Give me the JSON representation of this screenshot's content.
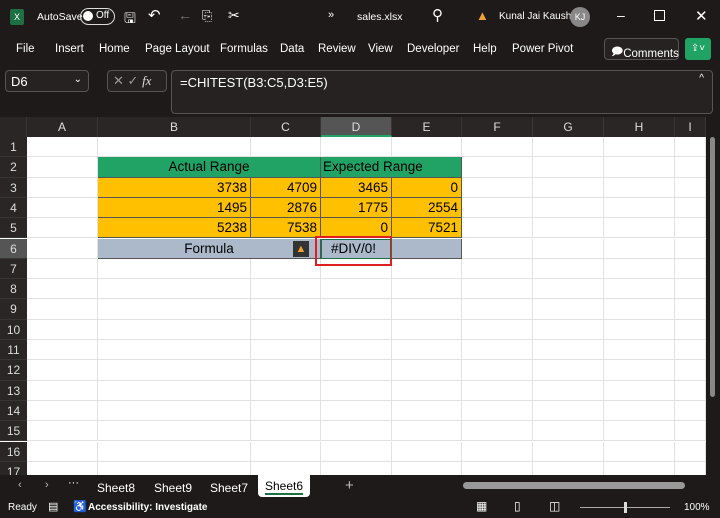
{
  "titlebar": {
    "autosave": "AutoSave",
    "toggle": "Off",
    "filename": "sales.xlsx",
    "user": "Kunal Jai Kaushik",
    "initials": "KJ"
  },
  "ribbon": {
    "tabs": [
      "File",
      "Insert",
      "Home",
      "Page Layout",
      "Formulas",
      "Data",
      "Review",
      "View",
      "Developer",
      "Help",
      "Power Pivot"
    ],
    "comments": "Comments"
  },
  "formula_bar": {
    "name_box": "D6",
    "formula": "=CHITEST(B3:C5,D3:E5)"
  },
  "columns": [
    "A",
    "B",
    "C",
    "D",
    "E",
    "F",
    "G",
    "H",
    "I"
  ],
  "rows": [
    "1",
    "2",
    "3",
    "4",
    "5",
    "6",
    "7",
    "8",
    "9",
    "10",
    "11",
    "12",
    "13",
    "14",
    "15",
    "16",
    "17"
  ],
  "table": {
    "header_actual": "Actual Range",
    "header_expected": "Expected Range",
    "data": [
      [
        "3738",
        "4709",
        "3465",
        "0"
      ],
      [
        "1495",
        "2876",
        "1775",
        "2554"
      ],
      [
        "5238",
        "7538",
        "0",
        "7521"
      ]
    ],
    "formula_label": "Formula",
    "result": "#DIV/0!"
  },
  "colors": {
    "header_green": "#21a366",
    "data_orange": "#ffc000",
    "formula_row": "#acb9ca",
    "selection_red": "#e02020"
  },
  "sheets": {
    "tabs": [
      "Sheet8",
      "Sheet9",
      "Sheet7",
      "Sheet6"
    ],
    "active": "Sheet6"
  },
  "status": {
    "ready": "Ready",
    "accessibility": "Accessibility: Investigate",
    "zoom": "100%"
  }
}
